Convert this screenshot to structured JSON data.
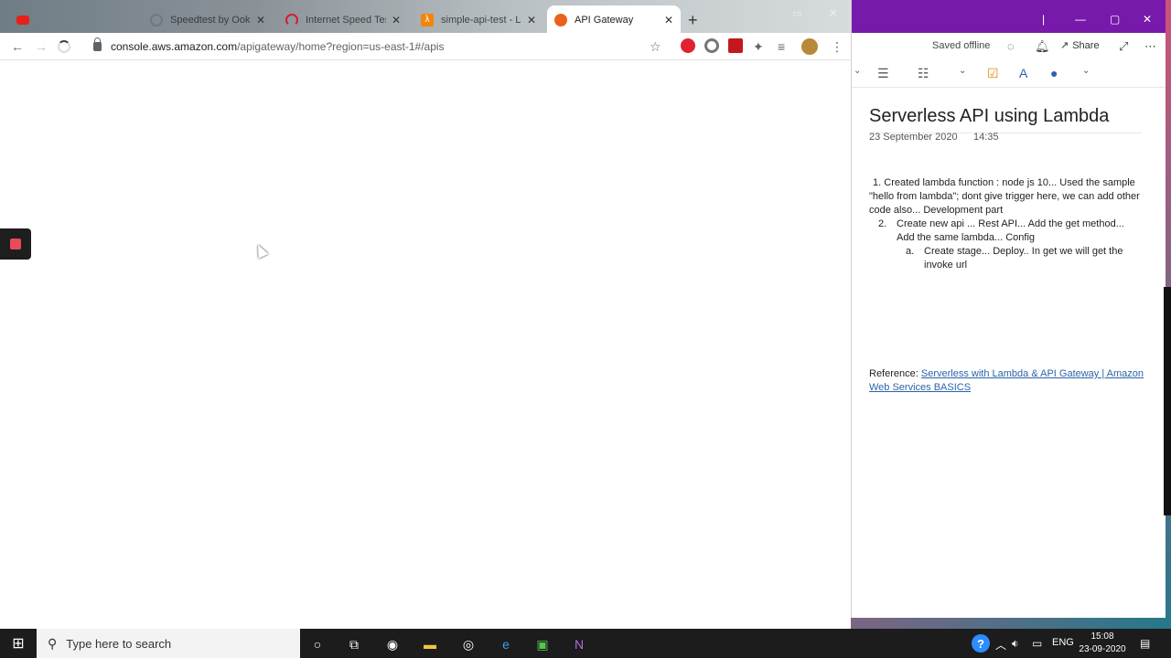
{
  "browser": {
    "tabs": [
      {
        "label": "",
        "favicon_color": "#e62117",
        "icon": "youtube-icon"
      },
      {
        "label": "Speedtest by Ookla",
        "favicon_color": "#6b7a83",
        "icon": "speedometer-icon"
      },
      {
        "label": "Internet Speed Test |",
        "favicon_color": "#d11f36",
        "icon": "gauge-icon"
      },
      {
        "label": "simple-api-test - Lam",
        "favicon_color": "#f0860a",
        "icon": "lambda-icon"
      },
      {
        "label": "API Gateway",
        "favicon_color": "#e9621c",
        "icon": "aws-icon",
        "active": true
      }
    ],
    "url_host": "console.aws.amazon.com",
    "url_path": "/apigateway/home?region=us-east-1#/apis"
  },
  "onenote": {
    "saved_status": "Saved offline",
    "share_label": "Share",
    "page_title": "Serverless API using Lambda",
    "date": "23 September 2020",
    "time": "14:35",
    "items": {
      "item1_num": "1.",
      "item1": "Created lambda function : node js 10... Used the sample \"hello from lambda\"; dont give trigger here, we can add other code also... Development part",
      "item2_num": "2.",
      "item2": "Create new api ... Rest API... Add the get method... Add the same lambda... Config",
      "item3_num": "a.",
      "item3": "Create stage... Deploy.. In get we will get the invoke url"
    },
    "reference_label": "Reference:",
    "reference_link": "Serverless with Lambda & API Gateway | Amazon Web Services BASICS",
    "accent_color": "#7719aa"
  },
  "taskbar": {
    "search_placeholder": "Type here to search",
    "language": "ENG",
    "time": "15:08",
    "date": "23-09-2020"
  }
}
